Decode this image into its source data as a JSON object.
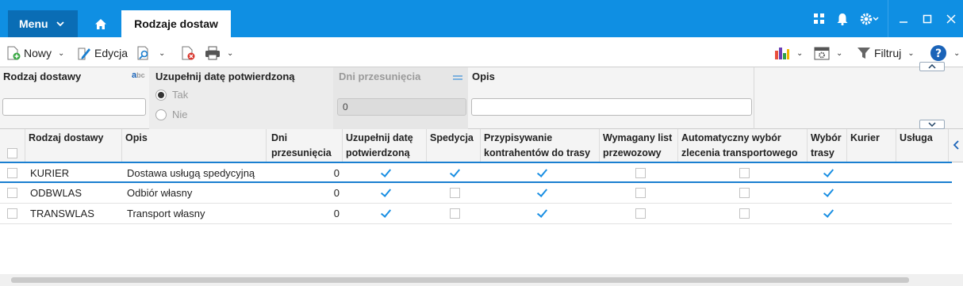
{
  "titlebar": {
    "menu_label": "Menu",
    "active_tab": "Rodzaje dostaw"
  },
  "toolbar": {
    "new_label": "Nowy",
    "edit_label": "Edycja",
    "filter_label": "Filtruj"
  },
  "filters": {
    "type_label": "Rodzaj dostawy",
    "confirm_label": "Uzupełnij datę potwierdzoną",
    "opt_yes": "Tak",
    "opt_no": "Nie",
    "delay_label": "Dni przesunięcia",
    "delay_value": "0",
    "desc_label": "Opis"
  },
  "columns": [
    "Rodzaj dostawy",
    "Opis",
    "Dni przesunięcia",
    "Uzupełnij datę potwierdzoną",
    "Spedycja",
    "Przypisywanie kontrahentów do trasy",
    "Wymagany list przewozowy",
    "Automatyczny wybór zlecenia transportowego",
    "Wybór trasy",
    "Kurier",
    "Usługa"
  ],
  "rows": [
    {
      "code": "KURIER",
      "desc": "Dostawa usługą spedycyjną",
      "days": "0",
      "confirm": true,
      "spedycja": true,
      "assign": true,
      "waybill": false,
      "auto": false,
      "route": true
    },
    {
      "code": "ODBWLAS",
      "desc": "Odbiór własny",
      "days": "0",
      "confirm": true,
      "spedycja": false,
      "assign": true,
      "waybill": false,
      "auto": false,
      "route": true
    },
    {
      "code": "TRANSWLAS",
      "desc": "Transport własny",
      "days": "0",
      "confirm": true,
      "spedycja": false,
      "assign": true,
      "waybill": false,
      "auto": false,
      "route": true
    }
  ]
}
